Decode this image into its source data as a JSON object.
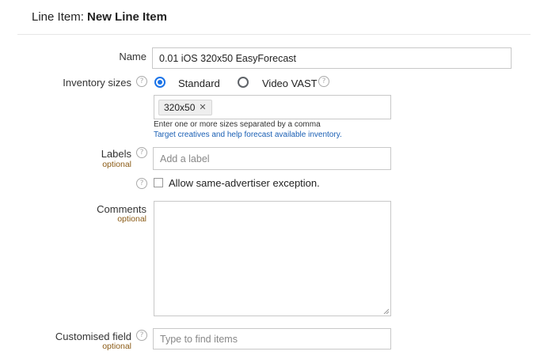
{
  "header": {
    "prefix": "Line Item: ",
    "title": "New Line Item"
  },
  "form": {
    "name": {
      "label": "Name",
      "value": "0.01 iOS 320x50 EasyForecast"
    },
    "inventory_sizes": {
      "label": "Inventory sizes",
      "options": [
        {
          "label": "Standard",
          "selected": true
        },
        {
          "label": "Video VAST",
          "selected": false
        }
      ],
      "chips": [
        "320x50"
      ],
      "hint": "Enter one or more sizes separated by a comma",
      "link": "Target creatives and help forecast available inventory."
    },
    "labels": {
      "label": "Labels",
      "optional": "optional",
      "placeholder": "Add a label"
    },
    "same_advertiser": {
      "label": "Allow same-advertiser exception.",
      "checked": false
    },
    "comments": {
      "label": "Comments",
      "optional": "optional",
      "value": ""
    },
    "customised_field": {
      "label": "Customised field",
      "optional": "optional",
      "placeholder": "Type to find items"
    }
  },
  "icons": {
    "help": "question-circle-icon",
    "remove": "close-icon"
  },
  "colors": {
    "accent": "#1a73e8",
    "optional_text": "#8a5a14",
    "link": "#1a5fb4"
  }
}
